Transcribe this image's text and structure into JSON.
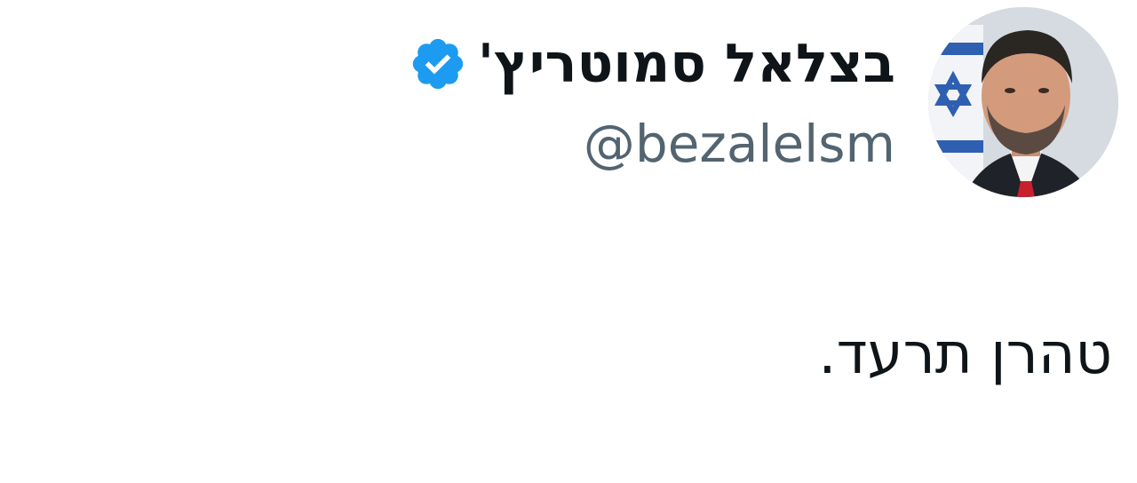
{
  "author": {
    "display_name": "בצלאל סמוטריץ'",
    "handle": "@bezalelsm",
    "verified": true,
    "verified_icon": "verified-badge-icon",
    "avatar": "profile-photo"
  },
  "tweet": {
    "text": "טהרן תרעד."
  },
  "colors": {
    "background": "#ffffff",
    "text_primary": "#0f1419",
    "text_secondary": "#536471",
    "verified_blue": "#1d9bf0"
  }
}
